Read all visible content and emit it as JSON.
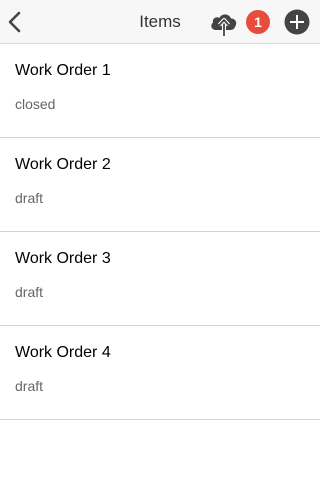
{
  "header": {
    "title": "Items",
    "back_icon": "chevron-left-icon",
    "upload_icon": "cloud-upload-icon",
    "badge_count": "1",
    "add_icon": "plus-circle-icon"
  },
  "items": [
    {
      "title": "Work Order 1",
      "status": "closed"
    },
    {
      "title": "Work Order 2",
      "status": "draft"
    },
    {
      "title": "Work Order 3",
      "status": "draft"
    },
    {
      "title": "Work Order 4",
      "status": "draft"
    }
  ],
  "colors": {
    "badge": "#e74c3c",
    "navbar_bg": "#f7f7f7",
    "icon": "#444444"
  }
}
